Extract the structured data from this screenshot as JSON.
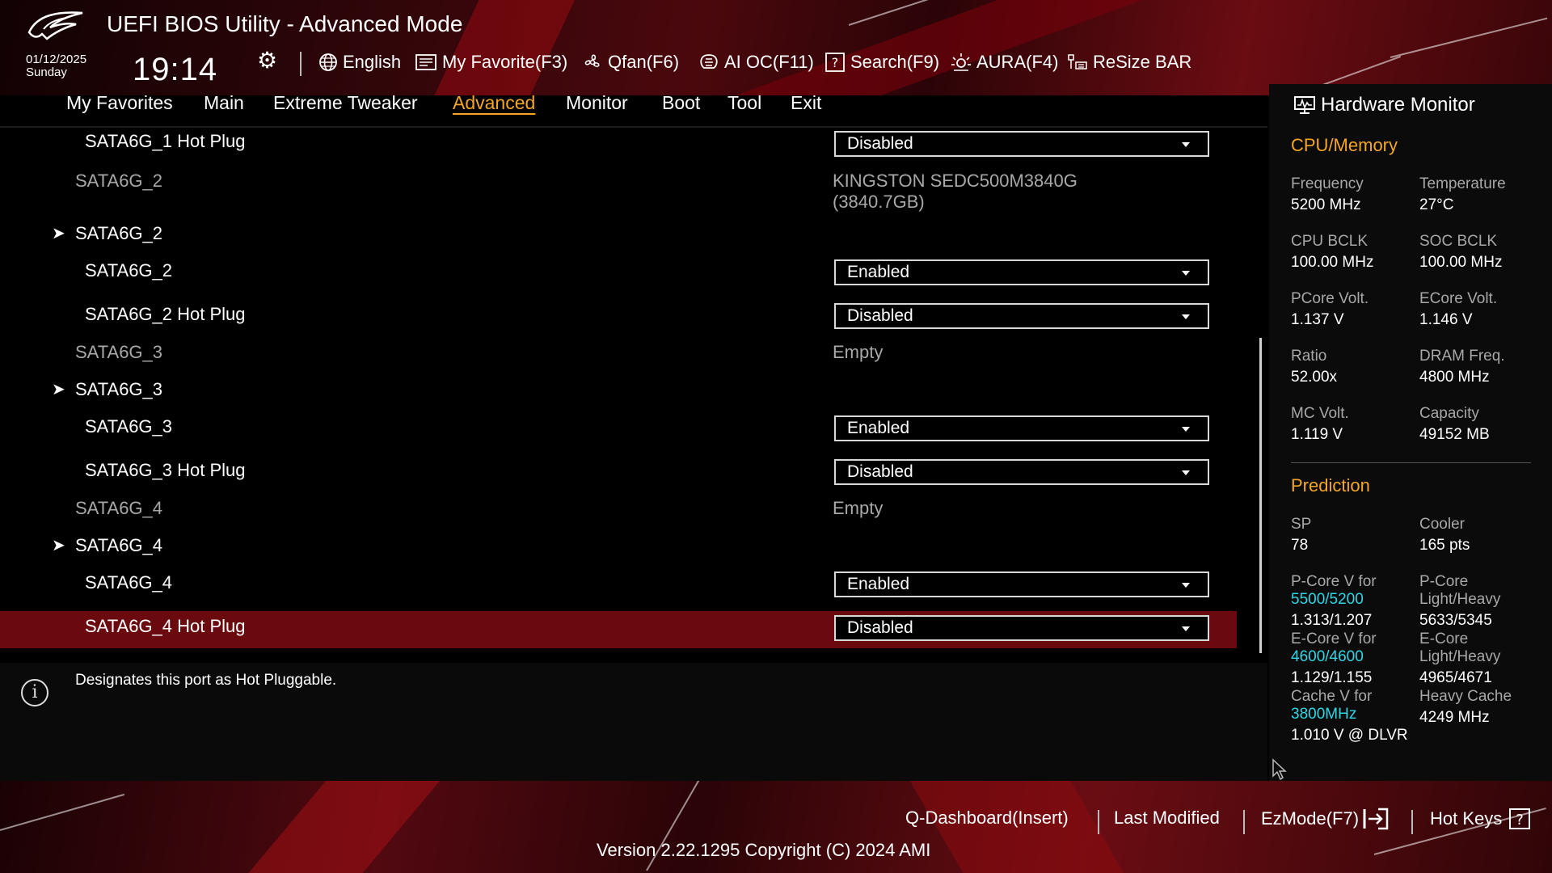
{
  "header": {
    "title": "UEFI BIOS Utility - Advanced Mode",
    "date": "01/12/2025",
    "day": "Sunday",
    "time": "19:14"
  },
  "toolbar": [
    {
      "label": "English",
      "icon": "globe-icon"
    },
    {
      "label": "My Favorite(F3)",
      "icon": "favorite-icon"
    },
    {
      "label": "Qfan(F6)",
      "icon": "fan-icon"
    },
    {
      "label": "AI OC(F11)",
      "icon": "ai-chip-icon"
    },
    {
      "label": "Search(F9)",
      "icon": "search-question-icon"
    },
    {
      "label": "AURA(F4)",
      "icon": "aura-light-icon"
    },
    {
      "label": "ReSize BAR",
      "icon": "resize-bar-icon"
    }
  ],
  "nav": {
    "items": [
      "My Favorites",
      "Main",
      "Extreme Tweaker",
      "Advanced",
      "Monitor",
      "Boot",
      "Tool",
      "Exit"
    ],
    "active": "Advanced"
  },
  "settings": {
    "sata1_hotplug": {
      "label": "SATA6G_1 Hot Plug",
      "value": "Disabled"
    },
    "sata2_info": {
      "label": "SATA6G_2",
      "value": "KINGSTON SEDC500M3840G",
      "value2": "(3840.7GB)"
    },
    "sata2_group": {
      "label": "SATA6G_2"
    },
    "sata2_port": {
      "label": "SATA6G_2",
      "value": "Enabled"
    },
    "sata2_hotplug": {
      "label": "SATA6G_2 Hot Plug",
      "value": "Disabled"
    },
    "sata3_info": {
      "label": "SATA6G_3",
      "value": "Empty"
    },
    "sata3_group": {
      "label": "SATA6G_3"
    },
    "sata3_port": {
      "label": "SATA6G_3",
      "value": "Enabled"
    },
    "sata3_hotplug": {
      "label": "SATA6G_3 Hot Plug",
      "value": "Disabled"
    },
    "sata4_info": {
      "label": "SATA6G_4",
      "value": "Empty"
    },
    "sata4_group": {
      "label": "SATA6G_4"
    },
    "sata4_port": {
      "label": "SATA6G_4",
      "value": "Enabled"
    },
    "sata4_hotplug": {
      "label": "SATA6G_4 Hot Plug",
      "value": "Disabled"
    }
  },
  "help": {
    "text": "Designates this port as Hot Pluggable."
  },
  "hw_monitor": {
    "title": "Hardware Monitor",
    "cpu_memory": {
      "title": "CPU/Memory",
      "frequency": {
        "label": "Frequency",
        "value": "5200 MHz"
      },
      "temperature": {
        "label": "Temperature",
        "value": "27°C"
      },
      "cpu_bclk": {
        "label": "CPU BCLK",
        "value": "100.00 MHz"
      },
      "soc_bclk": {
        "label": "SOC BCLK",
        "value": "100.00 MHz"
      },
      "pcore_volt": {
        "label": "PCore Volt.",
        "value": "1.137 V"
      },
      "ecore_volt": {
        "label": "ECore Volt.",
        "value": "1.146 V"
      },
      "ratio": {
        "label": "Ratio",
        "value": "52.00x"
      },
      "dram_freq": {
        "label": "DRAM Freq.",
        "value": "4800 MHz"
      },
      "mc_volt": {
        "label": "MC Volt.",
        "value": "1.119 V"
      },
      "capacity": {
        "label": "Capacity",
        "value": "49152 MB"
      }
    },
    "prediction": {
      "title": "Prediction",
      "sp": {
        "label": "SP",
        "value": "78"
      },
      "cooler": {
        "label": "Cooler",
        "value": "165 pts"
      },
      "pcore_v": {
        "label": "P-Core V for",
        "freq": "5500/5200",
        "value": "1.313/1.207"
      },
      "pcore_lh": {
        "label1": "P-Core",
        "label2": "Light/Heavy",
        "value": "5633/5345"
      },
      "ecore_v": {
        "label": "E-Core V for",
        "freq": "4600/4600",
        "value": "1.129/1.155"
      },
      "ecore_lh": {
        "label1": "E-Core",
        "label2": "Light/Heavy",
        "value": "4965/4671"
      },
      "cache_v": {
        "label": "Cache V for",
        "freq": "3800MHz",
        "value": "1.010 V @ DLVR"
      },
      "heavy_cache": {
        "label": "Heavy Cache",
        "value": "4249 MHz"
      }
    }
  },
  "footer": {
    "qdashboard": "Q-Dashboard(Insert)",
    "last_modified": "Last Modified",
    "ezmode": "EzMode(F7)",
    "hotkeys": "Hot Keys",
    "version": "Version 2.22.1295 Copyright (C) 2024 AMI"
  },
  "colors": {
    "accent": "#f5a623",
    "selected_row": "#6a0a0e",
    "highlight_cyan": "#2fd6e6",
    "dim_text": "#a8a8a8"
  }
}
